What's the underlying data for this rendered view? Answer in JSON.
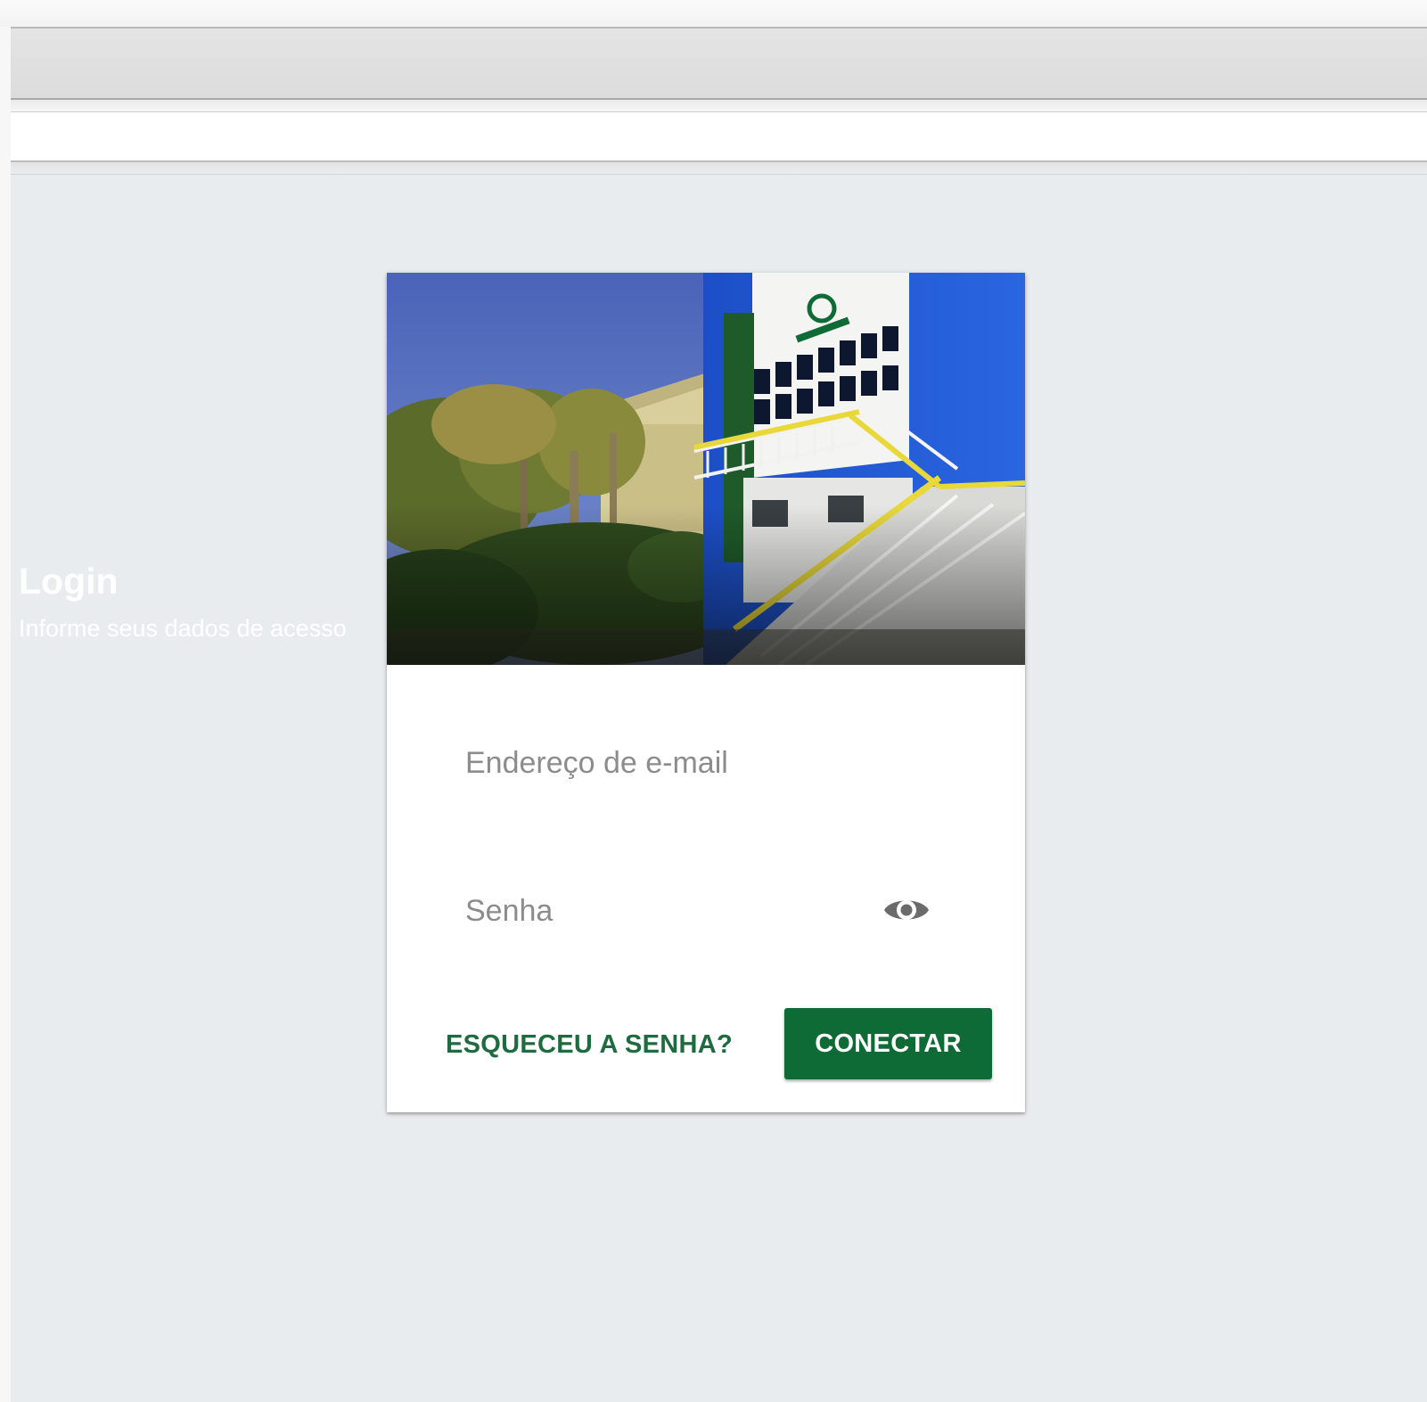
{
  "login": {
    "title": "Login",
    "subtitle": "Informe seus dados de acesso",
    "email_placeholder": "Endereço de e-mail",
    "password_placeholder": "Senha",
    "forgot_label": "ESQUECEU A SENHA?",
    "connect_label": "CONECTAR"
  },
  "icons": {
    "password_toggle": "eye-icon"
  },
  "colors": {
    "brand_green": "#0f6b35",
    "link_green": "#1f6b40",
    "page_background": "#e9ecef",
    "card_background": "#ffffff"
  }
}
